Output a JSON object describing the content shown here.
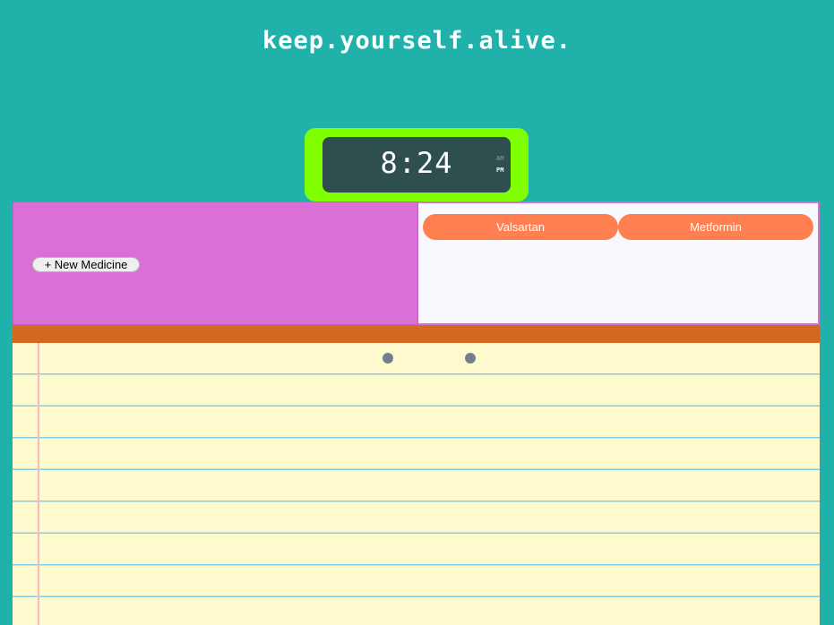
{
  "app": {
    "title": "keep.yourself.alive."
  },
  "clock": {
    "time": "8:24",
    "am_label": "AM",
    "pm_label": "PM",
    "active_period": "PM"
  },
  "controls": {
    "new_medicine_label": "+ New Medicine"
  },
  "medicines": [
    {
      "label": "Valsartan"
    },
    {
      "label": "Metformin"
    }
  ],
  "colors": {
    "background": "#20b2aa",
    "clock_frame": "#7fff00",
    "clock_face": "#2f4f4f",
    "left_panel": "#da70d6",
    "right_panel": "#f8f8ff",
    "medicine_button": "#ff7f50",
    "notebook_band": "#d2691e",
    "notebook_paper": "#fffacd",
    "notebook_lines": "#87ceeb",
    "notebook_margin": "#ffb6c1",
    "binder_holes": "#708090"
  }
}
